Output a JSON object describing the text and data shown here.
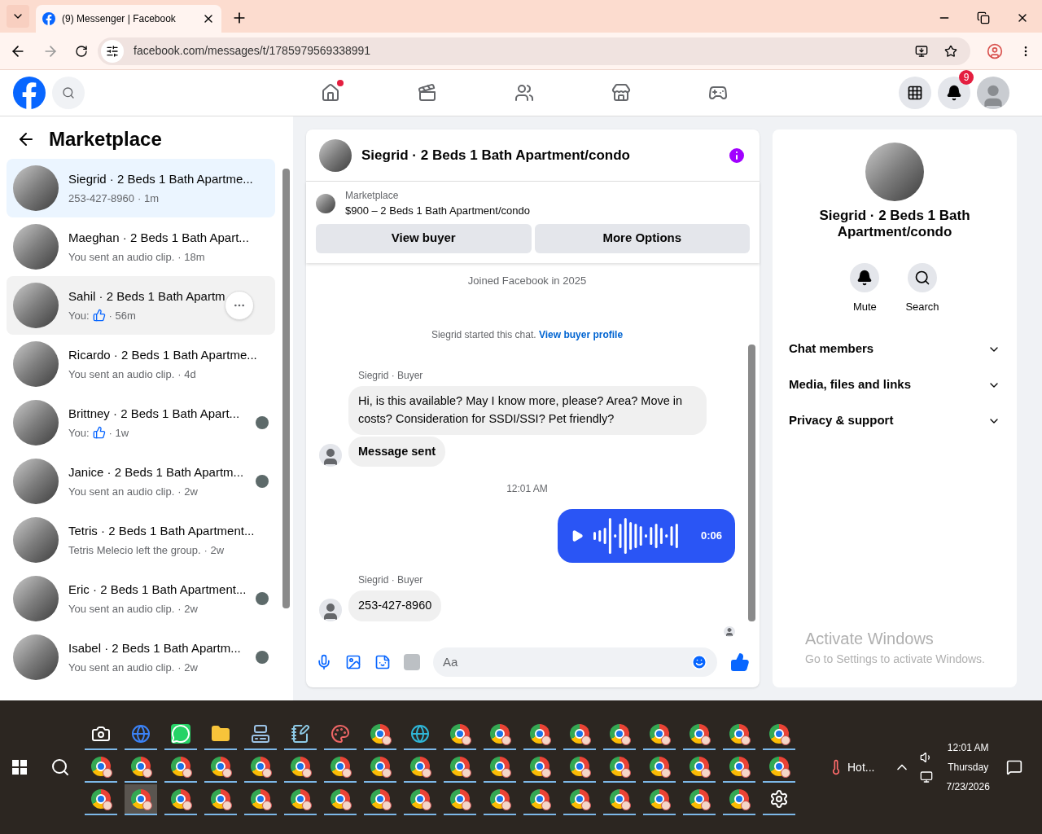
{
  "browser": {
    "tab_title": "(9) Messenger | Facebook",
    "url": "facebook.com/messages/t/1785979569338991"
  },
  "header": {
    "nav": [
      {
        "kind": "home",
        "dot": true
      },
      {
        "kind": "video",
        "dot": false
      },
      {
        "kind": "friends",
        "dot": false
      },
      {
        "kind": "marketplace",
        "dot": false
      },
      {
        "kind": "gaming",
        "dot": false
      }
    ],
    "notification_count": "9"
  },
  "sidebar": {
    "title": "Marketplace",
    "conversations": [
      {
        "title": "Siegrid · 2 Beds 1 Bath Apartme...",
        "preview": "253-427-8960",
        "time": "· 1m",
        "like": false,
        "seen": false,
        "selected": true,
        "hovered": false
      },
      {
        "title": "Maeghan · 2 Beds 1 Bath Apart...",
        "preview": "You sent an audio clip.",
        "time": "· 18m",
        "like": false,
        "seen": false,
        "selected": false,
        "hovered": false
      },
      {
        "title": "Sahil · 2 Beds 1 Bath Apartm",
        "preview": "You:",
        "time": "· 56m",
        "like": true,
        "seen": false,
        "selected": false,
        "hovered": true
      },
      {
        "title": "Ricardo · 2 Beds 1 Bath Apartme...",
        "preview": "You sent an audio clip.",
        "time": "· 4d",
        "like": false,
        "seen": false,
        "selected": false,
        "hovered": false
      },
      {
        "title": "Brittney · 2 Beds 1 Bath Apart...",
        "preview": "You:",
        "time": "· 1w",
        "like": true,
        "seen": true,
        "selected": false,
        "hovered": false
      },
      {
        "title": "Janice · 2 Beds 1 Bath Apartm...",
        "preview": "You sent an audio clip.",
        "time": "· 2w",
        "like": false,
        "seen": true,
        "selected": false,
        "hovered": false
      },
      {
        "title": "Tetris · 2 Beds 1 Bath Apartment...",
        "preview": "Tetris Melecio left the group.",
        "time": "· 2w",
        "like": false,
        "seen": false,
        "selected": false,
        "hovered": false
      },
      {
        "title": "Eric · 2 Beds 1 Bath Apartment...",
        "preview": "You sent an audio clip.",
        "time": "· 2w",
        "like": false,
        "seen": true,
        "selected": false,
        "hovered": false
      },
      {
        "title": "Isabel · 2 Beds 1 Bath Apartm...",
        "preview": "You sent an audio clip.",
        "time": "· 2w",
        "like": false,
        "seen": true,
        "selected": false,
        "hovered": false
      }
    ]
  },
  "chat": {
    "title": "Siegrid · 2 Beds 1 Bath Apartment/condo",
    "listing": {
      "label": "Marketplace",
      "text": "$900 – 2 Beds 1 Bath Apartment/condo"
    },
    "buttons": [
      "View buyer",
      "More Options"
    ],
    "messages": [
      {
        "kind": "note",
        "text": "Joined Facebook in 2025"
      },
      {
        "kind": "started",
        "text": "Siegrid started this chat.",
        "link": "View buyer profile"
      },
      {
        "kind": "sender",
        "text": "Siegrid · Buyer"
      },
      {
        "kind": "incoming",
        "text": "Hi, is this available? May I know more, please? Area? Move in costs? Consideration for SSDI/SSI? Pet friendly?",
        "bold": false,
        "avatar": false
      },
      {
        "kind": "incoming",
        "text": "Message sent",
        "bold": true,
        "avatar": true
      },
      {
        "kind": "time",
        "text": "12:01 AM"
      },
      {
        "kind": "audio",
        "text": "0:06"
      },
      {
        "kind": "sender",
        "text": "Siegrid · Buyer"
      },
      {
        "kind": "incoming",
        "text": "253-427-8960",
        "bold": false,
        "avatar": true
      }
    ],
    "read_receipt": true,
    "composer": {
      "placeholder": "Aa"
    }
  },
  "details": {
    "title": "Siegrid · 2 Beds 1 Bath Apartment/condo",
    "actions": [
      {
        "kind": "mute",
        "label": "Mute"
      },
      {
        "kind": "search",
        "label": "Search"
      }
    ],
    "sections": [
      "Chat members",
      "Media, files and links",
      "Privacy & support"
    ],
    "activation": {
      "title": "Activate Windows",
      "text": "Go to Settings to activate Windows."
    }
  },
  "taskbar": {
    "rows": [
      [
        {
          "kind": "camera",
          "selected": false
        },
        {
          "kind": "globe",
          "selected": false
        },
        {
          "kind": "chat",
          "selected": false
        },
        {
          "kind": "folder",
          "selected": false
        },
        {
          "kind": "computer",
          "selected": false
        },
        {
          "kind": "notepad",
          "selected": false
        },
        {
          "kind": "paint",
          "selected": false
        },
        {
          "kind": "browser",
          "selected": false
        },
        {
          "kind": "edge",
          "selected": false
        },
        {
          "kind": "browser",
          "selected": false
        },
        {
          "kind": "browser",
          "selected": false
        },
        {
          "kind": "browser",
          "selected": false
        },
        {
          "kind": "browser",
          "selected": false
        },
        {
          "kind": "browser",
          "selected": false
        },
        {
          "kind": "browser",
          "selected": false
        },
        {
          "kind": "browser",
          "selected": false
        },
        {
          "kind": "browser",
          "selected": false
        },
        {
          "kind": "browser",
          "selected": false
        }
      ],
      [
        {
          "kind": "browser",
          "selected": false
        },
        {
          "kind": "browser",
          "selected": false
        },
        {
          "kind": "browser",
          "selected": false
        },
        {
          "kind": "browser",
          "selected": false
        },
        {
          "kind": "browser",
          "selected": false
        },
        {
          "kind": "browser",
          "selected": false
        },
        {
          "kind": "browser",
          "selected": false
        },
        {
          "kind": "browser",
          "selected": false
        },
        {
          "kind": "browser",
          "selected": false
        },
        {
          "kind": "browser",
          "selected": false
        },
        {
          "kind": "browser",
          "selected": false
        },
        {
          "kind": "browser",
          "selected": false
        },
        {
          "kind": "browser",
          "selected": false
        },
        {
          "kind": "browser",
          "selected": false
        },
        {
          "kind": "browser",
          "selected": false
        },
        {
          "kind": "browser",
          "selected": false
        },
        {
          "kind": "browser",
          "selected": false
        },
        {
          "kind": "browser",
          "selected": false
        }
      ],
      [
        {
          "kind": "browser",
          "selected": false
        },
        {
          "kind": "browser",
          "selected": true
        },
        {
          "kind": "browser",
          "selected": false
        },
        {
          "kind": "browser",
          "selected": false
        },
        {
          "kind": "browser",
          "selected": false
        },
        {
          "kind": "browser",
          "selected": false
        },
        {
          "kind": "browser",
          "selected": false
        },
        {
          "kind": "browser",
          "selected": false
        },
        {
          "kind": "browser",
          "selected": false
        },
        {
          "kind": "browser",
          "selected": false
        },
        {
          "kind": "browser",
          "selected": false
        },
        {
          "kind": "browser",
          "selected": false
        },
        {
          "kind": "browser",
          "selected": false
        },
        {
          "kind": "browser",
          "selected": false
        },
        {
          "kind": "browser",
          "selected": false
        },
        {
          "kind": "browser",
          "selected": false
        },
        {
          "kind": "browser",
          "selected": false
        },
        {
          "kind": "settings",
          "selected": false
        }
      ]
    ],
    "weather": "Hot...",
    "time": "12:01 AM",
    "day": "Thursday",
    "date": "7/23/2026"
  }
}
